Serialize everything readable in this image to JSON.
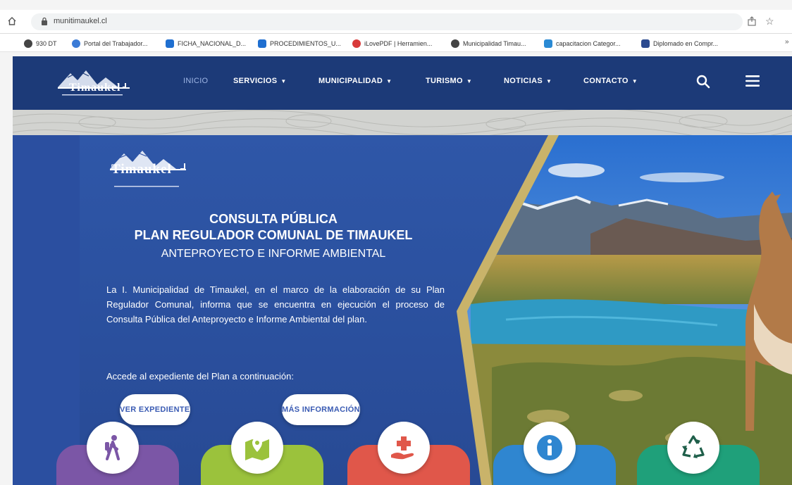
{
  "browser": {
    "url": "munitimaukel.cl",
    "bookmarks": [
      {
        "label": "930 DT",
        "color": "#444444"
      },
      {
        "label": "Portal del Trabajador...",
        "color": "#3b7bd6"
      },
      {
        "label": "FICHA_NACIONAL_D...",
        "color": "#1f6fd0"
      },
      {
        "label": "PROCEDIMIENTOS_U...",
        "color": "#1f6fd0"
      },
      {
        "label": "iLovePDF | Herramien...",
        "color": "#d83a3a"
      },
      {
        "label": "Municipalidad Timau...",
        "color": "#444444"
      },
      {
        "label": "capacitacion Categor...",
        "color": "#2a8ad4"
      },
      {
        "label": "Diplomado en Compr...",
        "color": "#2b4a8f"
      }
    ],
    "more": "»"
  },
  "nav": {
    "logo_text": "Timaukel",
    "items": [
      {
        "label": "INICIO",
        "caret": ""
      },
      {
        "label": "SERVICIOS",
        "caret": "▼"
      },
      {
        "label": "MUNICIPALIDAD",
        "caret": "▼"
      },
      {
        "label": "TURISMO",
        "caret": "▼"
      },
      {
        "label": "NOTICIAS",
        "caret": "▼"
      },
      {
        "label": "CONTACTO",
        "caret": "▼"
      }
    ]
  },
  "hero": {
    "logo_text": "Timaukel",
    "title_1": "CONSULTA PÚBLICA",
    "title_2": "PLAN REGULADOR COMUNAL DE TIMAUKEL",
    "title_3": "ANTEPROYECTO E INFORME AMBIENTAL",
    "body": "La I. Municipalidad de Timaukel, en el marco de la elaboración de su Plan Regulador Comunal, informa que se encuentra en ejecución el proceso de Consulta Pública del Anteproyecto e Informe Ambiental del plan.",
    "cta_text": "Accede al expediente del Plan a continuación:",
    "btn_expediente": "VER EXPEDIENTE",
    "btn_info": "MÁS INFORMACIÓN"
  },
  "tiles": [
    {
      "icon": "hiker-icon",
      "color": "#7b56a6"
    },
    {
      "icon": "map-pin-icon",
      "color": "#9bc23c"
    },
    {
      "icon": "health-hand-icon",
      "color": "#e0574a"
    },
    {
      "icon": "info-icon",
      "color": "#2f86d0"
    },
    {
      "icon": "recycle-icon",
      "color": "#1fa07a"
    }
  ],
  "colors": {
    "nav_bg": "#1c3a78",
    "hero_bg": "#2b4fa0",
    "button_text": "#3a5bb3",
    "gold_accent": "#c9b36a"
  }
}
